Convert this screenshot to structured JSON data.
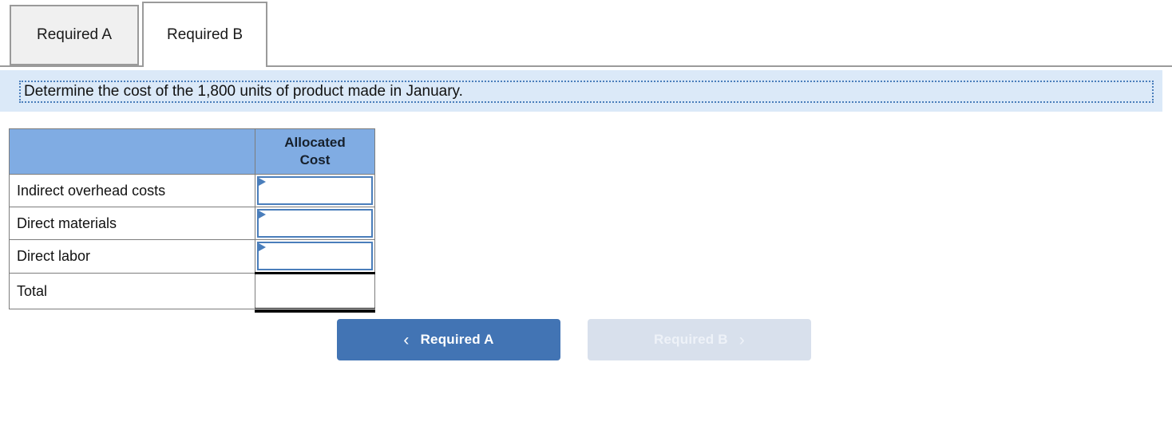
{
  "tabs": [
    {
      "label": "Required A",
      "state": "inactive"
    },
    {
      "label": "Required B",
      "state": "active"
    }
  ],
  "instruction": {
    "text": "Determine the cost of the 1,800 units of product made in January."
  },
  "table": {
    "headers": [
      "",
      "Allocated Cost"
    ],
    "header_col2_line1": "Allocated",
    "header_col2_line2": "Cost",
    "rows": [
      {
        "label": "Indirect overhead costs",
        "value": "",
        "type": "input"
      },
      {
        "label": "Direct materials",
        "value": "",
        "type": "input"
      },
      {
        "label": "Direct labor",
        "value": "",
        "type": "input"
      },
      {
        "label": "Total",
        "value": "",
        "type": "total"
      }
    ]
  },
  "nav": {
    "prev_label": "Required A",
    "prev_icon": "chevron-left",
    "prev_glyph": "‹",
    "next_label": "Required B",
    "next_icon": "chevron-right",
    "next_glyph": "›"
  },
  "colors": {
    "header_blue": "#80ace3",
    "banner_blue": "#dbe9f8",
    "accent_blue": "#4a7ebb",
    "button_blue": "#4274b4",
    "button_disabled": "#d8e0ec",
    "border_gray": "#7d7d7d"
  }
}
